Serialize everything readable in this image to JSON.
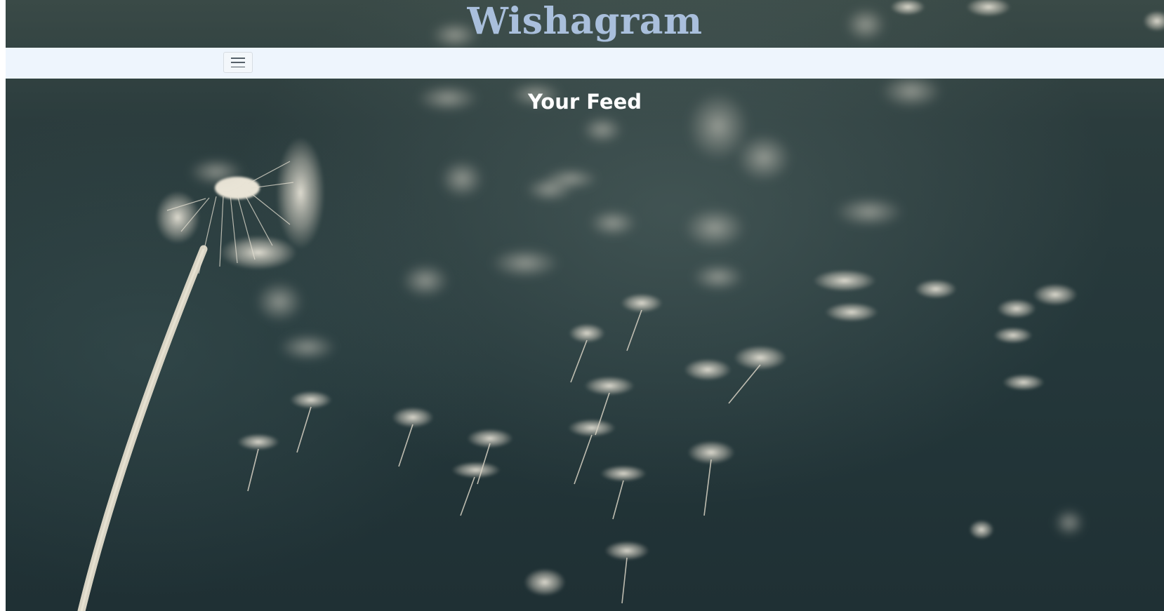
{
  "header": {
    "brand": "Wishagram"
  },
  "navbar": {
    "toggler_icon": "hamburger-menu-icon"
  },
  "main": {
    "title": "Your Feed"
  },
  "background": {
    "image": "dandelion-seeds-blowing",
    "tone_colors": [
      "#24373a",
      "#3a4a47",
      "#e8e3d6"
    ]
  }
}
